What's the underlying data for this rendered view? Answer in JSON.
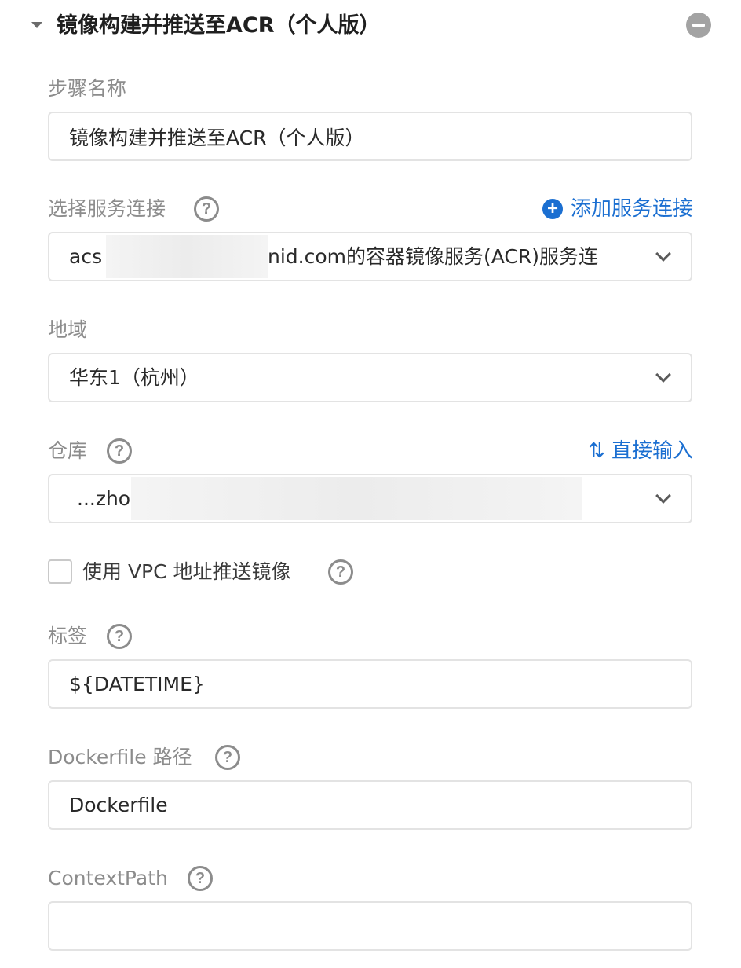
{
  "section": {
    "title": "镜像构建并推送至ACR（个人版）"
  },
  "fields": {
    "step_name": {
      "label": "步骤名称",
      "value": "镜像构建并推送至ACR（个人版）"
    },
    "service_connection": {
      "label": "选择服务连接",
      "action_label": "添加服务连接",
      "value_prefix": "acs",
      "value_suffix": "nid.com的容器镜像服务(ACR)服务连"
    },
    "region": {
      "label": "地域",
      "value": "华东1（杭州）"
    },
    "repository": {
      "label": "仓库",
      "action_label": "直接输入",
      "value_prefix": "...zho"
    },
    "vpc": {
      "label": "使用 VPC 地址推送镜像",
      "checked": false
    },
    "tag": {
      "label": "标签",
      "value": "${DATETIME}"
    },
    "dockerfile_path": {
      "label": "Dockerfile 路径",
      "value": "Dockerfile"
    },
    "context_path": {
      "label": "ContextPath",
      "value": ""
    }
  },
  "icons": {
    "help": "?",
    "plus": "+",
    "swap": "⇅"
  },
  "colors": {
    "accent": "#1b6fd1",
    "label": "#8c8c8c",
    "border": "#e3e3e3",
    "text": "#292929"
  }
}
